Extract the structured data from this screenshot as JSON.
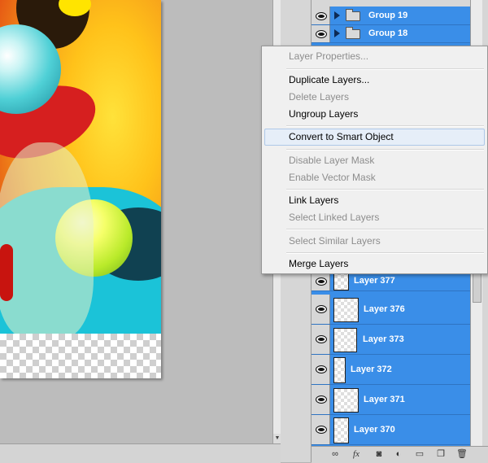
{
  "layers_panel": {
    "groups": [
      {
        "name": "Group 19",
        "icon": "folder-icon"
      },
      {
        "name": "Group 18",
        "icon": "folder-icon"
      }
    ],
    "layers": [
      {
        "name": "Layer 377"
      },
      {
        "name": "Layer 376"
      },
      {
        "name": "Layer 373"
      },
      {
        "name": "Layer 372"
      },
      {
        "name": "Layer 371"
      },
      {
        "name": "Layer 370"
      }
    ],
    "footer_icons": [
      "link-icon",
      "fx-icon",
      "layer-mask-icon",
      "adjustment-layer-icon",
      "new-group-icon",
      "new-layer-icon",
      "trash-icon"
    ],
    "footer_glyphs": {
      "fx": "fx"
    }
  },
  "context_menu": {
    "items": [
      {
        "label": "Layer Properties...",
        "enabled": false
      },
      {
        "label": "Duplicate Layers...",
        "enabled": true
      },
      {
        "label": "Delete Layers",
        "enabled": false
      },
      {
        "label": "Ungroup Layers",
        "enabled": true
      },
      {
        "label": "Convert to Smart Object",
        "enabled": true,
        "highlighted": true
      },
      {
        "label": "Disable Layer Mask",
        "enabled": false
      },
      {
        "label": "Enable Vector Mask",
        "enabled": false
      },
      {
        "label": "Link Layers",
        "enabled": true
      },
      {
        "label": "Select Linked Layers",
        "enabled": false
      },
      {
        "label": "Select Similar Layers",
        "enabled": false
      },
      {
        "label": "Merge Layers",
        "enabled": true
      }
    ]
  },
  "colors": {
    "selection_blue": "#3a8ee8",
    "menu_background": "#f0f0f0",
    "disabled_text": "#8d8d8d"
  }
}
